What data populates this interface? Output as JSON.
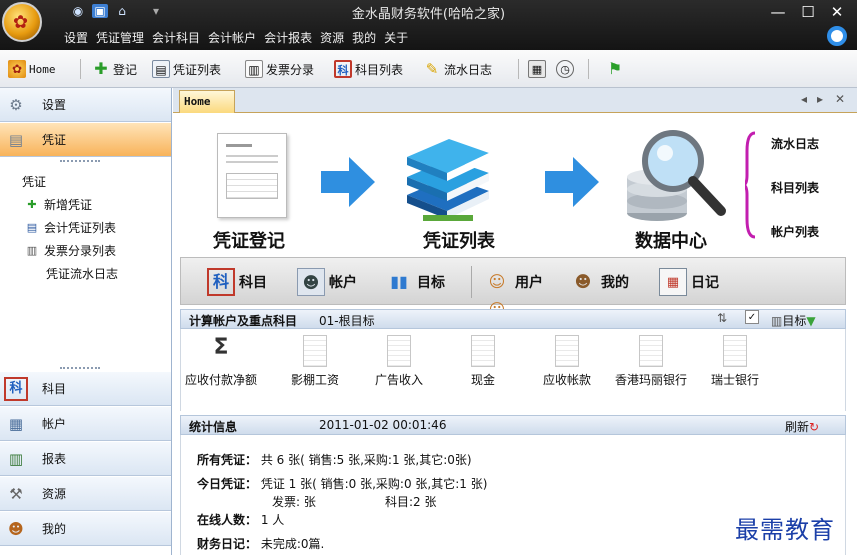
{
  "window": {
    "title": "金水晶财务软件(哈哈之家)"
  },
  "menu": [
    "设置",
    "凭证管理",
    "会计科目",
    "会计帐户",
    "会计报表",
    "资源",
    "我的",
    "关于"
  ],
  "toolbar": {
    "home": "Home",
    "register": "登记",
    "voucher_list": "凭证列表",
    "invoice": "发票分录",
    "account_list": "科目列表",
    "journal": "流水日志"
  },
  "sidebar": {
    "top_items": [
      {
        "label": "设置",
        "icon": "gear-icon"
      },
      {
        "label": "凭证",
        "icon": "voucher-icon"
      }
    ],
    "tree_root": "凭证",
    "tree": [
      {
        "label": "新增凭证",
        "icon": "add-doc-icon"
      },
      {
        "label": "会计凭证列表",
        "icon": "list-icon"
      },
      {
        "label": "发票分录列表",
        "icon": "invoice-icon"
      },
      {
        "label": "凭证流水日志",
        "icon": ""
      }
    ],
    "bottom_items": [
      {
        "label": "科目",
        "icon": "ke-icon"
      },
      {
        "label": "帐户",
        "icon": "account-icon"
      },
      {
        "label": "报表",
        "icon": "report-icon"
      },
      {
        "label": "资源",
        "icon": "tools-icon"
      },
      {
        "label": "我的",
        "icon": "user-icon"
      }
    ]
  },
  "tab": {
    "label": "Home"
  },
  "flow": {
    "step1": "凭证登记",
    "step2": "凭证列表",
    "step3": "数据中心",
    "links": [
      "流水日志",
      "科目列表",
      "帐户列表"
    ]
  },
  "iconbar": {
    "ke_glyph": "科",
    "items": [
      "科目",
      "帐户",
      "目标",
      "用户",
      "我的",
      "日记"
    ]
  },
  "accounts_panel": {
    "title": "计算帐户及重点科目",
    "subtitle": "01-根目标",
    "target_label": "目标",
    "items": [
      "应收付款净额",
      "影棚工资",
      "广告收入",
      "现金",
      "应收帐款",
      "香港玛丽银行",
      "瑞士银行"
    ]
  },
  "stats_panel": {
    "title": "统计信息",
    "datetime": "2011-01-02 00:01:46",
    "refresh": "刷新",
    "all_vouchers_label": "所有凭证：",
    "all_vouchers_value": "共 6 张( 销售:5 张,采购:1 张,其它:0张)",
    "today_vouchers_label": "今日凭证：",
    "today_vouchers_value": "凭证 1 张( 销售:0 张,采购:0 张,其它:1 张)",
    "today_invoice": "发票: 张",
    "today_accounts": "科目:2 张",
    "online_label": "在线人数：",
    "online_value": "1 人",
    "diary_label": "财务日记：",
    "diary_value": "未完成:0篇."
  },
  "watermark": "最需教育"
}
